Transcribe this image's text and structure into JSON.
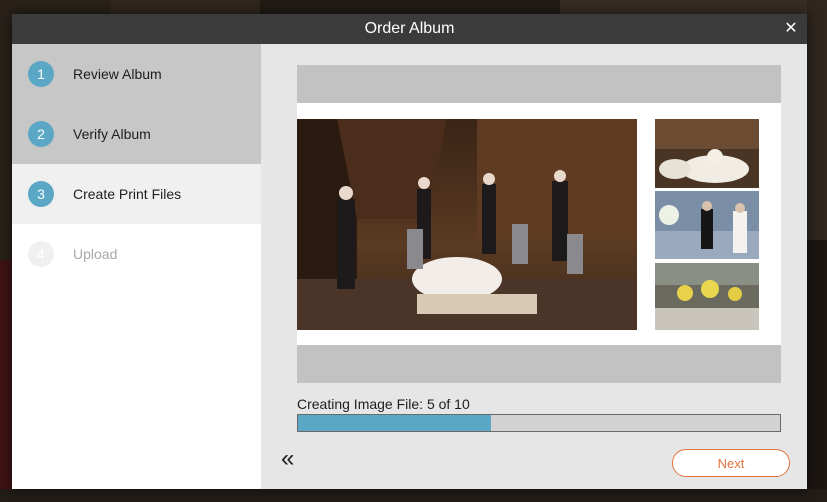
{
  "dialog": {
    "title": "Order Album",
    "close_glyph": "✕"
  },
  "steps": [
    {
      "number": "1",
      "label": "Review Album",
      "state": "done"
    },
    {
      "number": "2",
      "label": "Verify Album",
      "state": "done"
    },
    {
      "number": "3",
      "label": "Create Print Files",
      "state": "active"
    },
    {
      "number": "4",
      "label": "Upload",
      "state": "pending"
    }
  ],
  "preview": {
    "photos": [
      "wedding-party-on-staircase",
      "reception-hall-table",
      "couple-at-reception",
      "floral-centerpieces"
    ]
  },
  "progress": {
    "label": "Creating Image File: 5 of 10",
    "fraction": 0.4
  },
  "footer": {
    "back_glyph": "«",
    "next_label": "Next"
  },
  "colors": {
    "accent": "#5aa7c6",
    "next_button": "#e0743e",
    "titlebar": "#3b3b3b"
  },
  "icons": {
    "close": "close-icon",
    "back": "double-chevron-left-icon"
  }
}
